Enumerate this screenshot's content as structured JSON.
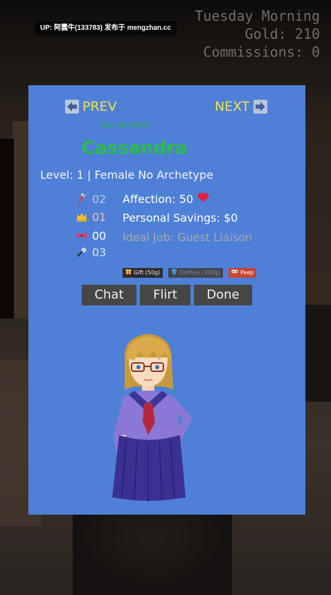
{
  "hud": {
    "day": "Tuesday Morning",
    "gold": "Gold: 210",
    "commissions": "Commissions: 0"
  },
  "watermark": "UP: 阿蠢牛(133783) 发布于 mengzhan.cc",
  "nav": {
    "prev": "PREV",
    "next": "NEXT"
  },
  "character": {
    "tag": "Rare RECRUIT",
    "name": "Cassandra",
    "level_line": "Level: 1 | Female No Archetype",
    "affection": "Affection: 50",
    "savings": "Personal Savings: $0",
    "ideal_job": "Ideal Job: Guest Liaison"
  },
  "stats": [
    {
      "icon": "dancer-icon",
      "value": "02"
    },
    {
      "icon": "crown-icon",
      "value": "01"
    },
    {
      "icon": "bow-icon",
      "value": "00"
    },
    {
      "icon": "microphone-icon",
      "value": "03"
    }
  ],
  "actions_small": {
    "gift": "Gift (50g)",
    "clothes": "Clothes (300g)",
    "peep": "Peep"
  },
  "actions": {
    "chat": "Chat",
    "flirt": "Flirt",
    "done": "Done"
  },
  "colors": {
    "panel": "#4f80d7",
    "nav": "#f1e24f",
    "name": "#2cbb4e",
    "button": "#464646",
    "peep": "#c94433"
  }
}
